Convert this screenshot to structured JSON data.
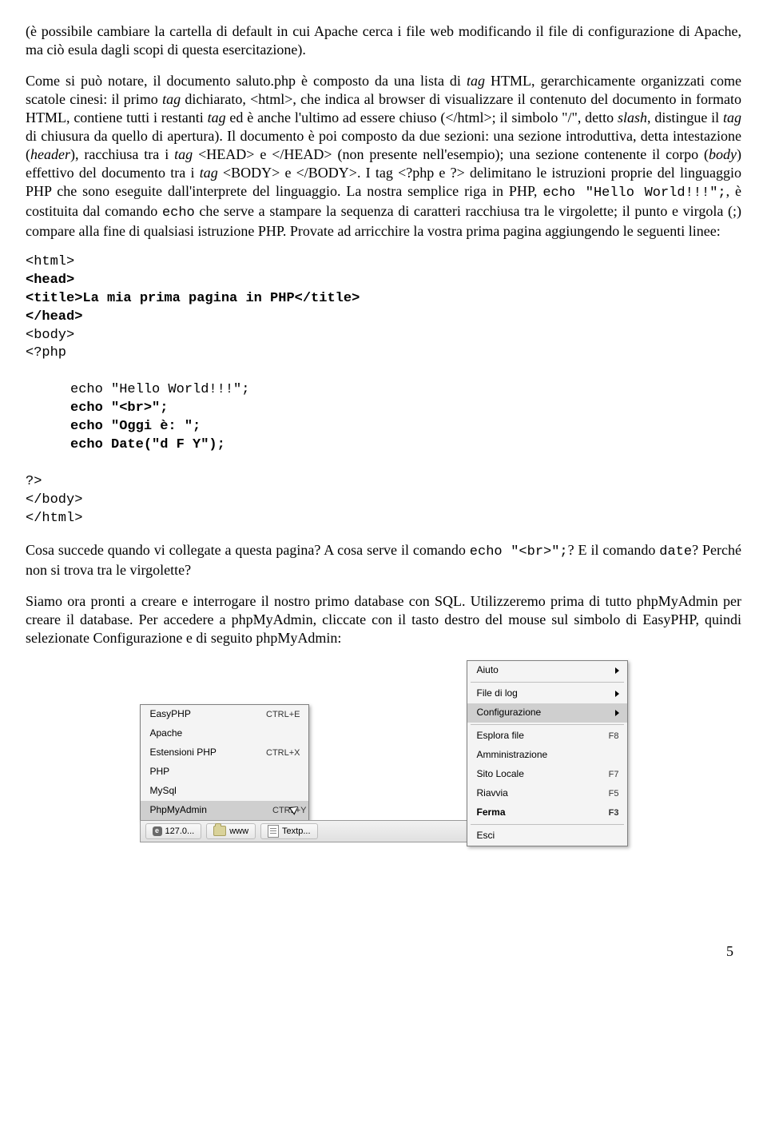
{
  "para1": "(è possibile cambiare la cartella di default in cui Apache cerca i file web modificando il file di configurazione di Apache, ma ciò esula dagli scopi di questa esercitazione).",
  "para2_a": "Come si può notare, il documento saluto.php è composto da una lista di ",
  "para2_b": " HTML, gerarchicamente organizzati come scatole cinesi: il primo ",
  "para2_c": " dichiarato, <html>, che indica al browser di visualizzare il contenuto del documento in formato HTML, contiene tutti i restanti ",
  "para2_d": " ed è anche l'ultimo ad essere chiuso (</html>; il simbolo \"/\", detto ",
  "para2_e": ", distingue il ",
  "para2_f": " di chiusura da quello di apertura). Il documento è poi composto da due sezioni: una sezione introduttiva, detta intestazione (",
  "para2_g": "), racchiusa tra i ",
  "para2_h": " <HEAD> e </HEAD> (non presente nell'esempio); una sezione contenente il corpo (",
  "para2_i": ") effettivo del documento tra i ",
  "para2_j": " <BODY> e </BODY>. I tag <?php e ?> delimitano le istruzioni proprie del linguaggio PHP che sono eseguite dall'interprete del linguaggio. La nostra semplice riga in PHP, ",
  "para2_k": ", è costituita dal comando ",
  "para2_l": " che serve a stampare la sequenza di caratteri racchiusa tra le virgolette; il punto e virgola (;) compare alla fine di qualsiasi istruzione PHP. Provate ad arricchire la vostra prima pagina aggiungendo le seguenti linee:",
  "tag_word": "tag",
  "slash_word": "slash",
  "header_word": "header",
  "body_word": "body",
  "echo_hello": "echo \"Hello World!!!\";",
  "echo_cmd": "echo",
  "code": {
    "l1": "<html>",
    "l2": "<head>",
    "l3": "<title>La mia prima pagina in PHP</title>",
    "l4": "</head>",
    "l5": "<body>",
    "l6": "<?php",
    "l7": "echo \"Hello World!!!\";",
    "l8": "echo \"<br>\";",
    "l9": "echo \"Oggi è: \";",
    "l10": "echo Date(\"d F Y\");",
    "l11": "?>",
    "l12": "</body>",
    "l13": "</html>"
  },
  "para3_a": "Cosa succede quando vi collegate a questa pagina? A cosa serve il comando ",
  "para3_cmd1": "echo \"<br>\";",
  "para3_b": "? E il comando ",
  "para3_cmd2": "date",
  "para3_c": "? Perché non si trova tra le virgolette?",
  "para4": "Siamo ora pronti a creare e interrogare il nostro primo database con SQL. Utilizzeremo prima di tutto phpMyAdmin per creare il database. Per accedere a phpMyAdmin, cliccate con il tasto destro del mouse sul simbolo di EasyPHP, quindi selezionate Configurazione e di seguito phpMyAdmin:",
  "menu_left": {
    "items": [
      {
        "label": "EasyPHP",
        "shortcut": "CTRL+E"
      },
      {
        "label": "Apache",
        "shortcut": ""
      },
      {
        "label": "Estensioni PHP",
        "shortcut": "CTRL+X"
      },
      {
        "label": "PHP",
        "shortcut": ""
      },
      {
        "label": "MySql",
        "shortcut": ""
      },
      {
        "label": "PhpMyAdmin",
        "shortcut": "CTRL+Y",
        "highlighted": true
      }
    ]
  },
  "menu_right": {
    "items": [
      {
        "label": "Aiuto",
        "arrow": true
      },
      {
        "label": "File di log",
        "arrow": true
      },
      {
        "label": "Configurazione",
        "arrow": true,
        "highlighted": true
      },
      {
        "label": "Esplora file",
        "shortcut": "F8"
      },
      {
        "label": "Amministrazione",
        "shortcut": ""
      },
      {
        "label": "Sito Locale",
        "shortcut": "F7"
      },
      {
        "label": "Riavvia",
        "shortcut": "F5"
      },
      {
        "label": "Ferma",
        "shortcut": "F3",
        "bold": true
      },
      {
        "label": "Esci",
        "shortcut": ""
      }
    ]
  },
  "taskbar": {
    "item1": "127.0...",
    "item2": "www",
    "item3": "Textp..."
  },
  "page_number": "5"
}
